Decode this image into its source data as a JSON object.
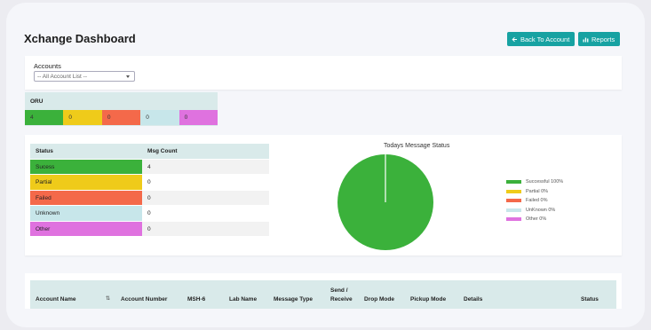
{
  "header": {
    "title": "Xchange Dashboard",
    "back_label": "Back To Account",
    "reports_label": "Reports"
  },
  "accounts": {
    "label": "Accounts",
    "selected": "-- All Account List --"
  },
  "oru": {
    "label": "ORU",
    "counts": [
      {
        "value": "4",
        "color": "#3bb13b"
      },
      {
        "value": "0",
        "color": "#efcb1a"
      },
      {
        "value": "0",
        "color": "#f4694a"
      },
      {
        "value": "0",
        "color": "#c7e6ea"
      },
      {
        "value": "0",
        "color": "#df72df"
      }
    ]
  },
  "status_table": {
    "headers": [
      "Status",
      "Msg Count"
    ],
    "rows": [
      {
        "status": "Sucess",
        "count": "4",
        "color": "#3bb13b"
      },
      {
        "status": "Partial",
        "count": "0",
        "color": "#efcb1a"
      },
      {
        "status": "Failed",
        "count": "0",
        "color": "#f4694a"
      },
      {
        "status": "Unknown",
        "count": "0",
        "color": "#c7e6ea"
      },
      {
        "status": "Other",
        "count": "0",
        "color": "#df72df"
      }
    ]
  },
  "chart_data": {
    "type": "pie",
    "title": "Todays Message Status",
    "series": [
      {
        "name": "Successful 100%",
        "value": 4,
        "color": "#3bb13b"
      },
      {
        "name": "Partial 0%",
        "value": 0,
        "color": "#efcb1a"
      },
      {
        "name": "Failed 0%",
        "value": 0,
        "color": "#f4694a"
      },
      {
        "name": "UnKnown 0%",
        "value": 0,
        "color": "#c7e6ea"
      },
      {
        "name": "Other 0%",
        "value": 0,
        "color": "#df72df"
      }
    ],
    "legend": "right"
  },
  "messages_table": {
    "columns": [
      "Account Name",
      "Account Number",
      "MSH-6",
      "Lab Name",
      "Message Type",
      "Send / Receive",
      "Drop Mode",
      "Pickup Mode",
      "Details",
      "Status"
    ]
  }
}
